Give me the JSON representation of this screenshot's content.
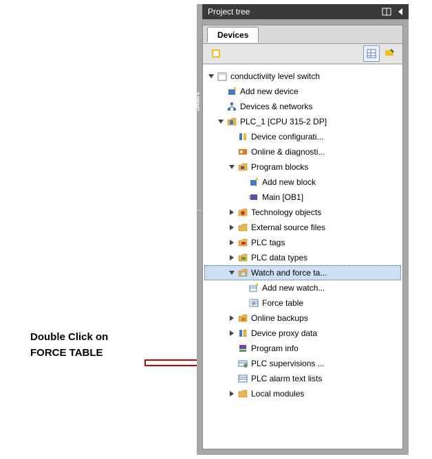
{
  "annotation": {
    "line1": "Double Click on",
    "line2": "FORCE TABLE"
  },
  "panel": {
    "title": "Project tree",
    "side_tab": "Start",
    "tab": "Devices"
  },
  "tree": {
    "root": "conductiviity level switch",
    "add_device": "Add new device",
    "devices_networks": "Devices & networks",
    "plc": "PLC_1 [CPU 315-2 DP]",
    "device_config": "Device configurati...",
    "online_diag": "Online & diagnosti...",
    "program_blocks": "Program blocks",
    "add_block": "Add new block",
    "main_ob1": "Main [OB1]",
    "tech_objects": "Technology objects",
    "ext_sources": "External source files",
    "plc_tags": "PLC tags",
    "plc_data_types": "PLC data types",
    "watch_force": "Watch and force ta...",
    "add_watch": "Add new watch...",
    "force_table": "Force table",
    "online_backups": "Online backups",
    "device_proxy": "Device proxy data",
    "program_info": "Program info",
    "plc_supervisions": "PLC supervisions ...",
    "plc_alarm": "PLC alarm text lists",
    "local_modules": "Local modules"
  }
}
